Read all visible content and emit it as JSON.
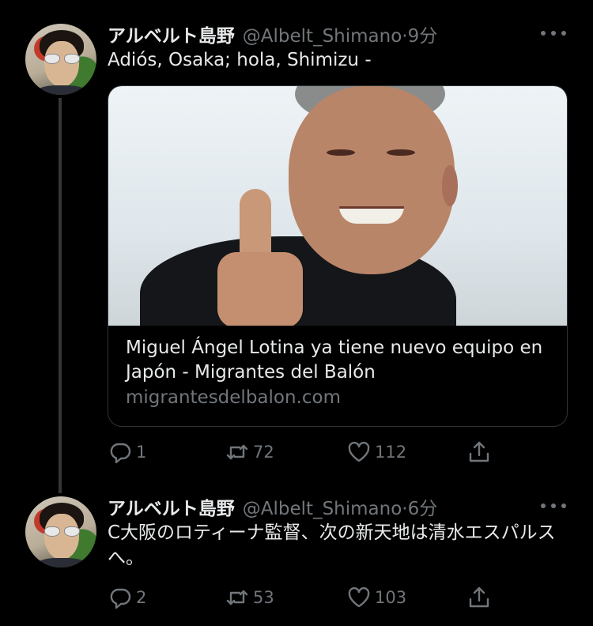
{
  "tweets": [
    {
      "author_name": "アルベルト島野",
      "author_handle": "@Albelt_Shimano",
      "separator": "·",
      "time": "9分",
      "text": "Adiós, Osaka; hola, Shimizu -",
      "card": {
        "title": "Miguel Ángel Lotina ya tiene nuevo equipo en Japón - Migrantes del Balón",
        "domain": "migrantesdelbalon.com"
      },
      "replies": "1",
      "retweets": "72",
      "likes": "112"
    },
    {
      "author_name": "アルベルト島野",
      "author_handle": "@Albelt_Shimano",
      "separator": "·",
      "time": "6分",
      "text": "C大阪のロティーナ監督、次の新天地は清水エスパルスへ。",
      "replies": "2",
      "retweets": "53",
      "likes": "103"
    }
  ],
  "colors": {
    "background": "#000000",
    "text": "#e7e9ea",
    "secondary": "#71767b",
    "border": "#2f3336"
  }
}
